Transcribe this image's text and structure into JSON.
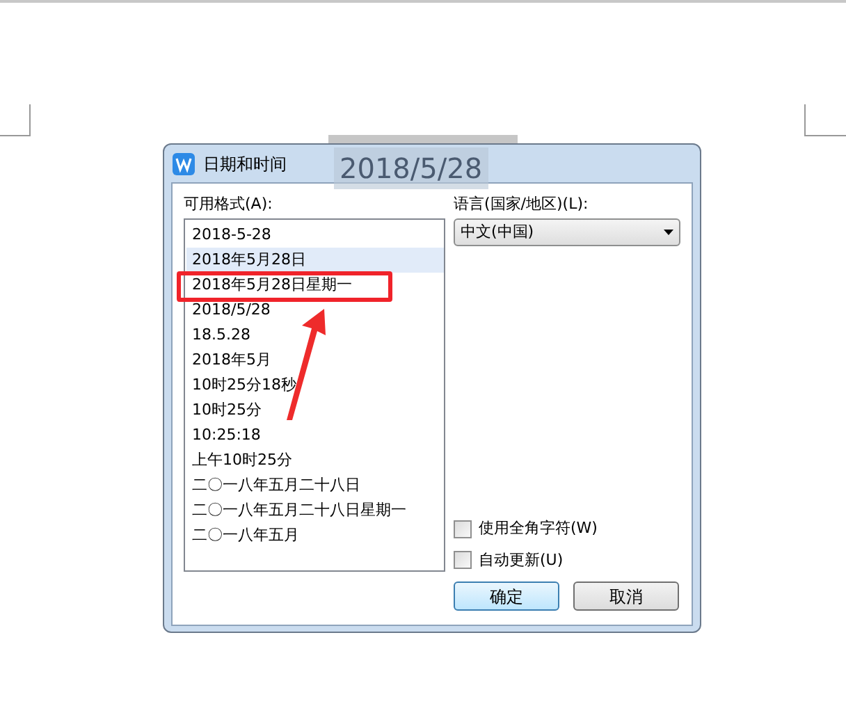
{
  "document": {
    "blurred_text": "2018/5/28"
  },
  "dialog": {
    "title": "日期和时间"
  },
  "formats": {
    "label": "可用格式(A):",
    "items": [
      {
        "text": "2018-5-28",
        "selected": false
      },
      {
        "text": "2018年5月28日",
        "selected": true
      },
      {
        "text": "2018年5月28日星期一",
        "selected": false,
        "annotated": true
      },
      {
        "text": "2018/5/28",
        "selected": false
      },
      {
        "text": "18.5.28",
        "selected": false
      },
      {
        "text": "2018年5月",
        "selected": false
      },
      {
        "text": "10时25分18秒",
        "selected": false
      },
      {
        "text": "10时25分",
        "selected": false
      },
      {
        "text": "10:25:18",
        "selected": false
      },
      {
        "text": "上午10时25分",
        "selected": false
      },
      {
        "text": "二〇一八年五月二十八日",
        "selected": false
      },
      {
        "text": "二〇一八年五月二十八日星期一",
        "selected": false
      },
      {
        "text": "二〇一八年五月",
        "selected": false
      }
    ]
  },
  "language": {
    "label": "语言(国家/地区)(L):",
    "value": "中文(中国)"
  },
  "options": [
    {
      "label": "使用全角字符(W)",
      "checked": false
    },
    {
      "label": "自动更新(U)",
      "checked": false
    }
  ],
  "buttons": [
    {
      "label": "确定",
      "default": true
    },
    {
      "label": "取消",
      "default": false
    }
  ]
}
